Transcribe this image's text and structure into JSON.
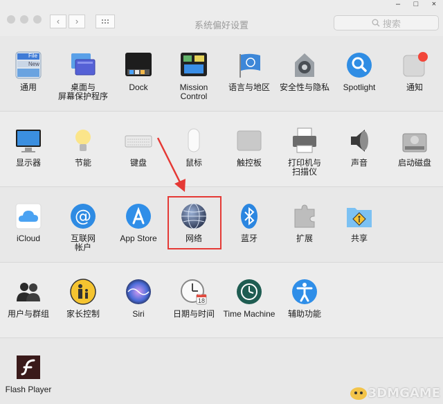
{
  "window": {
    "title": "系统偏好设置",
    "controls": {
      "minimize": "–",
      "maximize": "□",
      "close": "×"
    },
    "nav": {
      "back": "‹",
      "forward": "›"
    },
    "search_placeholder": "搜索"
  },
  "sections": [
    {
      "items": [
        {
          "label": "通用",
          "icon": "general-icon"
        },
        {
          "label": "桌面与\n屏幕保护程序",
          "icon": "desktop-screensaver-icon"
        },
        {
          "label": "Dock",
          "icon": "dock-icon"
        },
        {
          "label": "Mission\nControl",
          "icon": "mission-control-icon"
        },
        {
          "label": "语言与地区",
          "icon": "language-region-icon"
        },
        {
          "label": "安全性与隐私",
          "icon": "security-privacy-icon"
        },
        {
          "label": "Spotlight",
          "icon": "spotlight-icon"
        },
        {
          "label": "通知",
          "icon": "notifications-icon"
        }
      ]
    },
    {
      "items": [
        {
          "label": "显示器",
          "icon": "displays-icon"
        },
        {
          "label": "节能",
          "icon": "energy-saver-icon"
        },
        {
          "label": "键盘",
          "icon": "keyboard-icon"
        },
        {
          "label": "鼠标",
          "icon": "mouse-icon"
        },
        {
          "label": "触控板",
          "icon": "trackpad-icon"
        },
        {
          "label": "打印机与\n扫描仪",
          "icon": "printers-scanners-icon"
        },
        {
          "label": "声音",
          "icon": "sound-icon"
        },
        {
          "label": "启动磁盘",
          "icon": "startup-disk-icon"
        }
      ]
    },
    {
      "items": [
        {
          "label": "iCloud",
          "icon": "icloud-icon"
        },
        {
          "label": "互联网\n帐户",
          "icon": "internet-accounts-icon"
        },
        {
          "label": "App Store",
          "icon": "app-store-icon"
        },
        {
          "label": "网络",
          "icon": "network-icon"
        },
        {
          "label": "蓝牙",
          "icon": "bluetooth-icon"
        },
        {
          "label": "扩展",
          "icon": "extensions-icon"
        },
        {
          "label": "共享",
          "icon": "sharing-icon"
        }
      ]
    },
    {
      "items": [
        {
          "label": "用户与群组",
          "icon": "users-groups-icon"
        },
        {
          "label": "家长控制",
          "icon": "parental-controls-icon"
        },
        {
          "label": "Siri",
          "icon": "siri-icon"
        },
        {
          "label": "日期与时间",
          "icon": "date-time-icon"
        },
        {
          "label": "Time Machine",
          "icon": "time-machine-icon"
        },
        {
          "label": "辅助功能",
          "icon": "accessibility-icon"
        }
      ]
    },
    {
      "items": [
        {
          "label": "Flash Player",
          "icon": "flash-player-icon"
        }
      ]
    }
  ],
  "icon_text": {
    "general_file": "File",
    "general_new": "New",
    "calendar_day": "18",
    "calendar_month": "JUL"
  },
  "watermark": "3DMGAME",
  "colors": {
    "highlight": "#e53935",
    "accent_blue": "#1e7ae0",
    "background": "#ececec"
  }
}
